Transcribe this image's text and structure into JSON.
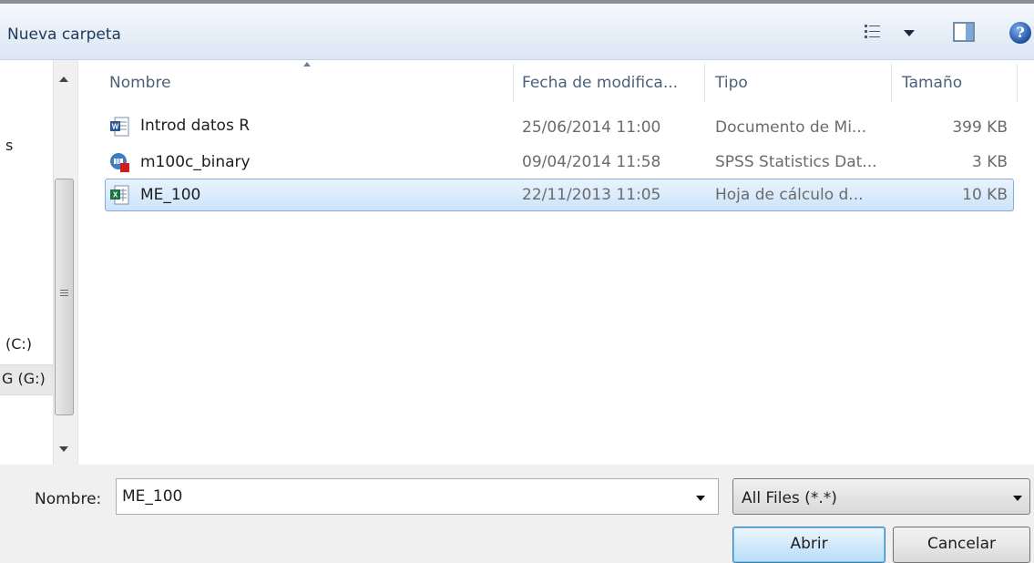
{
  "toolbar": {
    "new_folder": "Nueva carpeta",
    "icons": [
      "views-icon",
      "preview-pane-icon",
      "help-icon"
    ],
    "help_glyph": "?"
  },
  "nav_pane": {
    "fragments": [
      "s",
      "(C:)",
      "G (G:)"
    ]
  },
  "file_list": {
    "columns": {
      "name": "Nombre",
      "date": "Fecha de modifica...",
      "type": "Tipo",
      "size": "Tamaño"
    },
    "rows": [
      {
        "name": "Introd datos R",
        "date": "25/06/2014 11:00",
        "type": "Documento de Mi...",
        "size": "399 KB",
        "icon": "word-document-icon",
        "selected": false
      },
      {
        "name": "m100c_binary",
        "date": "09/04/2014 11:58",
        "type": "SPSS Statistics Dat...",
        "size": "3 KB",
        "icon": "spss-data-icon",
        "selected": false
      },
      {
        "name": "ME_100",
        "date": "22/11/2013 11:05",
        "type": "Hoja de cálculo d...",
        "size": "10 KB",
        "icon": "excel-workbook-icon",
        "selected": true
      }
    ]
  },
  "footer": {
    "name_label": "Nombre:",
    "name_value": "ME_100",
    "filter_value": "All Files (*.*)",
    "open_label": "Abrir",
    "cancel_label": "Cancelar"
  },
  "colors": {
    "selection_bg": "#cde4fa",
    "selection_border": "#84acdd",
    "header_text": "#4c607a",
    "toolbar_text": "#1e395b"
  }
}
